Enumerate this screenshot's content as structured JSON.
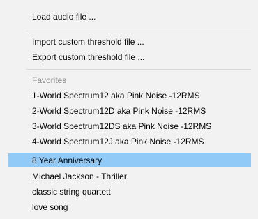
{
  "menu": {
    "file_items": [
      {
        "label": "Load audio file ..."
      }
    ],
    "threshold_items": [
      {
        "label": "Import custom threshold file ..."
      },
      {
        "label": "Export custom threshold file ..."
      }
    ],
    "favorites_header": "Favorites",
    "favorites": [
      {
        "label": "1-World Spectrum12 aka Pink Noise -12RMS"
      },
      {
        "label": "2-World Spectrum12D aka Pink Noise -12RMS"
      },
      {
        "label": "3-World Spectrum12DS aka Pink Noise -12RMS"
      },
      {
        "label": "4-World Spectrum12J aka Pink Noise -12RMS"
      },
      {
        "label": "8 Year Anniversary"
      },
      {
        "label": "Michael Jackson - Thriller"
      },
      {
        "label": "classic string quartett"
      },
      {
        "label": "love song"
      }
    ],
    "highlighted_favorite": "8 Year Anniversary",
    "colors": {
      "background": "#f2f2f2",
      "highlight": "#91c9f7",
      "disabled_text": "#8c8c8c",
      "separator": "#d7d7d7"
    }
  }
}
